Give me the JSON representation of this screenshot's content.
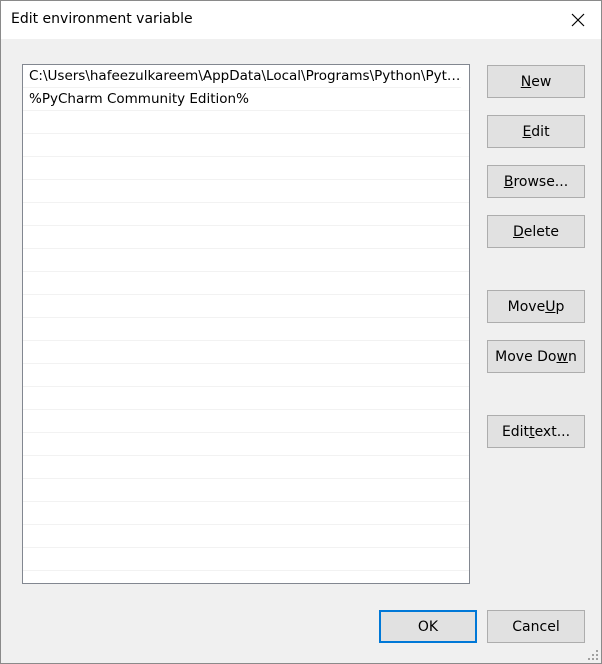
{
  "window": {
    "title": "Edit environment variable"
  },
  "list": {
    "items": [
      "C:\\Users\\hafeezulkareem\\AppData\\Local\\Programs\\Python\\Pyth...",
      "%PyCharm Community Edition%",
      "",
      "",
      "",
      "",
      "",
      "",
      "",
      "",
      "",
      "",
      "",
      "",
      "",
      "",
      "",
      "",
      "",
      "",
      "",
      ""
    ]
  },
  "buttons": {
    "new": {
      "pre": "",
      "key": "N",
      "post": "ew"
    },
    "edit": {
      "pre": "",
      "key": "E",
      "post": "dit"
    },
    "browse": {
      "pre": "",
      "key": "B",
      "post": "rowse..."
    },
    "delete": {
      "pre": "",
      "key": "D",
      "post": "elete"
    },
    "move_up": {
      "pre": "Move ",
      "key": "U",
      "post": "p"
    },
    "move_down": {
      "pre": "Move Do",
      "key": "w",
      "post": "n"
    },
    "edit_text": {
      "pre": "Edit ",
      "key": "t",
      "post": "ext..."
    },
    "ok": "OK",
    "cancel": "Cancel"
  },
  "icons": {
    "close": "close-icon",
    "resize": "resize-grip-icon"
  },
  "colors": {
    "accent": "#0078d7"
  }
}
